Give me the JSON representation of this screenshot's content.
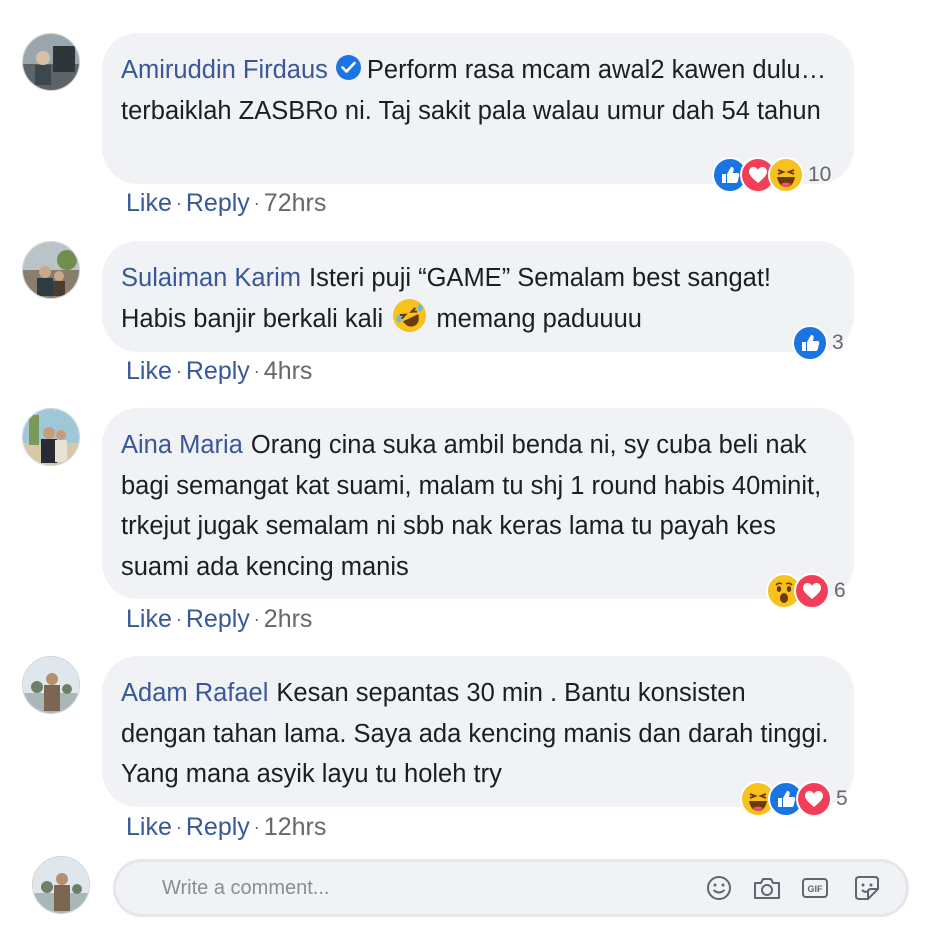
{
  "comments": [
    {
      "author": "Amiruddin Firdaus",
      "verified": true,
      "text": "Perform rasa mcam awal2 kawen dulu… terbaiklah ZASBRo ni. Taj sakit pala walau umur dah 54 tahun",
      "reactions": [
        "like-icon",
        "love-icon",
        "haha-icon"
      ],
      "reaction_count": "10",
      "like_label": "Like",
      "reply_label": "Reply",
      "time": "72hrs"
    },
    {
      "author": "Sulaiman Karim",
      "text_before": "Isteri puji “GAME” Semalam best sangat! Habis banjir berkali kali",
      "inline_emoji": "rolling-laughing-emoji",
      "text_after": "memang paduuuu",
      "reactions": [
        "like-icon"
      ],
      "reaction_count": "3",
      "like_label": "Like",
      "reply_label": "Reply",
      "time": "4hrs"
    },
    {
      "author": "Aina Maria",
      "text": "Orang cina suka ambil benda ni, sy cuba beli nak bagi semangat kat suami, malam tu shj 1 round habis 40minit, trkejut jugak semalam ni sbb nak keras lama tu payah kes suami ada kencing manis",
      "reactions": [
        "wow-icon",
        "love-icon"
      ],
      "reaction_count": "6",
      "like_label": "Like",
      "reply_label": "Reply",
      "time": "2hrs"
    },
    {
      "author": "Adam Rafael",
      "text": "Kesan sepantas 30 min . Bantu konsisten dengan tahan lama. Saya ada kencing manis dan darah tinggi. Yang mana asyik layu tu holeh try",
      "reactions": [
        "haha-icon",
        "like-icon",
        "love-icon"
      ],
      "reaction_count": "5",
      "like_label": "Like",
      "reply_label": "Reply",
      "time": "12hrs"
    }
  ],
  "composer": {
    "placeholder": "Write a comment...",
    "icons": [
      "emoji-icon",
      "camera-icon",
      "gif-icon",
      "sticker-icon"
    ]
  },
  "colors": {
    "link": "#385898",
    "bubble": "#f0f2f5",
    "like": "#1b74e4",
    "love": "#f33e58",
    "haha": "#f7c21d",
    "meta": "#65676b"
  }
}
